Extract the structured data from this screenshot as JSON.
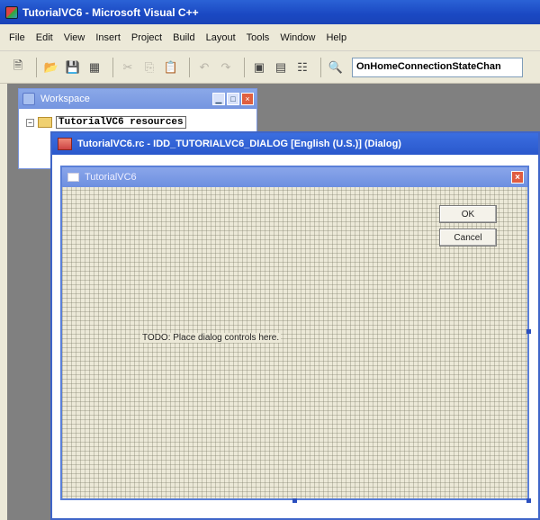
{
  "app": {
    "title": "TutorialVC6 - Microsoft Visual C++"
  },
  "menu": {
    "items": [
      "File",
      "Edit",
      "View",
      "Insert",
      "Project",
      "Build",
      "Layout",
      "Tools",
      "Window",
      "Help"
    ]
  },
  "toolbar": {
    "buttons": [
      {
        "icon": "new-icon",
        "glyph": "🗎"
      },
      {
        "icon": "open-icon",
        "glyph": "📂"
      },
      {
        "icon": "save-icon",
        "glyph": "💾"
      },
      {
        "icon": "save-all-icon",
        "glyph": "▦"
      },
      {
        "icon": "cut-icon",
        "glyph": "✂"
      },
      {
        "icon": "copy-icon",
        "glyph": "⎘"
      },
      {
        "icon": "paste-icon",
        "glyph": "📋"
      },
      {
        "icon": "undo-icon",
        "glyph": "↶"
      },
      {
        "icon": "redo-icon",
        "glyph": "↷"
      },
      {
        "icon": "workspace-icon",
        "glyph": "▣"
      },
      {
        "icon": "output-icon",
        "glyph": "▤"
      },
      {
        "icon": "windows-icon",
        "glyph": "☷"
      },
      {
        "icon": "find-in-files-icon",
        "glyph": "🔍"
      }
    ],
    "combo_value": "OnHomeConnectionStateChan"
  },
  "workspace": {
    "title": "Workspace",
    "tree_root": "TutorialVC6 resources"
  },
  "editor": {
    "title": "TutorialVC6.rc - IDD_TUTORIALVC6_DIALOG [English (U.S.)] (Dialog)"
  },
  "dialog": {
    "title": "TutorialVC6",
    "ok_label": "OK",
    "cancel_label": "Cancel",
    "todo_text": "TODO: Place dialog controls here."
  },
  "colors": {
    "title_bar": "#1a48c2",
    "chrome": "#ece9d8",
    "mdi_background": "#808080",
    "selection_handle": "#2b4fbf"
  }
}
